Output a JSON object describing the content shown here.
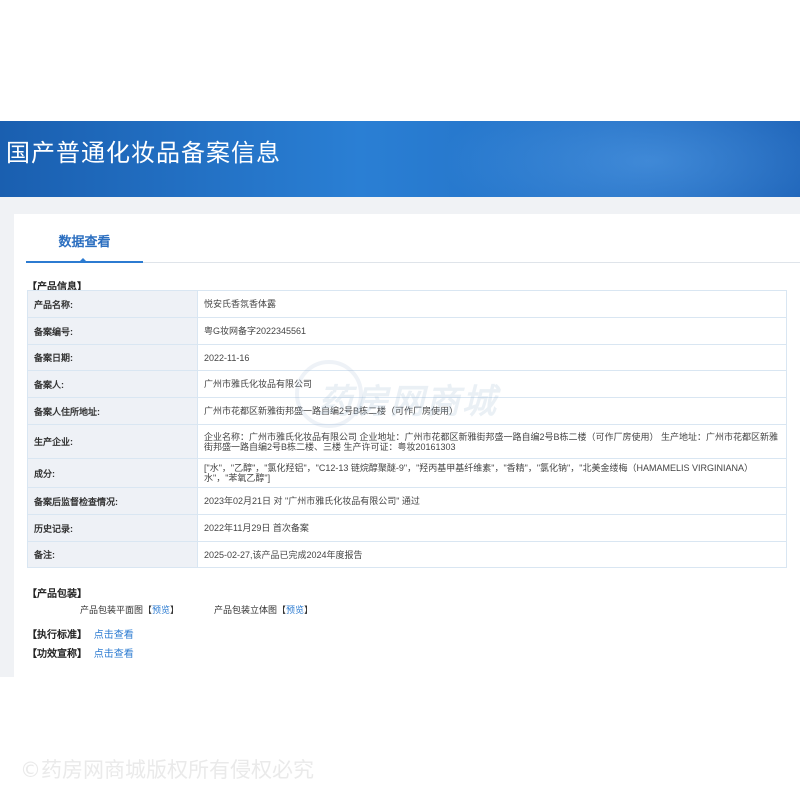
{
  "header": {
    "title": "国产普通化妆品备案信息"
  },
  "tabs": [
    {
      "label": "数据查看"
    }
  ],
  "product_info": {
    "section_label": "【产品信息】",
    "rows": [
      {
        "key": "产品名称:",
        "value": "悦安氏香氛香体露"
      },
      {
        "key": "备案编号:",
        "value": "粤G妆网备字2022345561"
      },
      {
        "key": "备案日期:",
        "value": "2022-11-16"
      },
      {
        "key": "备案人:",
        "value": "广州市雅氏化妆品有限公司"
      },
      {
        "key": "备案人住所地址:",
        "value": "广州市花都区新雅街邦盛一路自编2号B栋二楼（可作厂房使用）"
      },
      {
        "key": "生产企业:",
        "value": "企业名称：广州市雅氏化妆品有限公司 企业地址：广州市花都区新雅街邦盛一路自编2号B栋二楼（可作厂房使用） 生产地址：广州市花都区新雅街邦盛一路自编2号B栋二楼、三楼 生产许可证：粤妆20161303"
      },
      {
        "key": "成分:",
        "value": "[\"水\"，\"乙醇\"，\"氯化羟铝\"，\"C12-13 链烷醇聚醚-9\"，\"羟丙基甲基纤维素\"，\"香精\"，\"氯化钠\"，\"北美金缕梅（HAMAMELIS VIRGINIANA）水\"，\"苯氧乙醇\"]"
      },
      {
        "key": "备案后监督检查情况:",
        "value": "2023年02月21日 对 \"广州市雅氏化妆品有限公司\" 通过"
      },
      {
        "key": "历史记录:",
        "value": "2022年11月29日 首次备案"
      },
      {
        "key": "备注:",
        "value": "2025-02-27,该产品已完成2024年度报告"
      }
    ]
  },
  "packaging": {
    "section_label": "【产品包装】",
    "flat_label": "产品包装平面图",
    "solid_label": "产品包装立体图",
    "preview_link": "预览",
    "bracket_open": "【",
    "bracket_close": "】"
  },
  "standard": {
    "label": "【执行标准】",
    "link": "点击查看"
  },
  "efficacy": {
    "label": "【功效宣称】",
    "link": "点击查看"
  },
  "watermark": {
    "text": "药房网商城"
  },
  "footer": {
    "copyright": "©药房网商城版权所有侵权必究"
  }
}
